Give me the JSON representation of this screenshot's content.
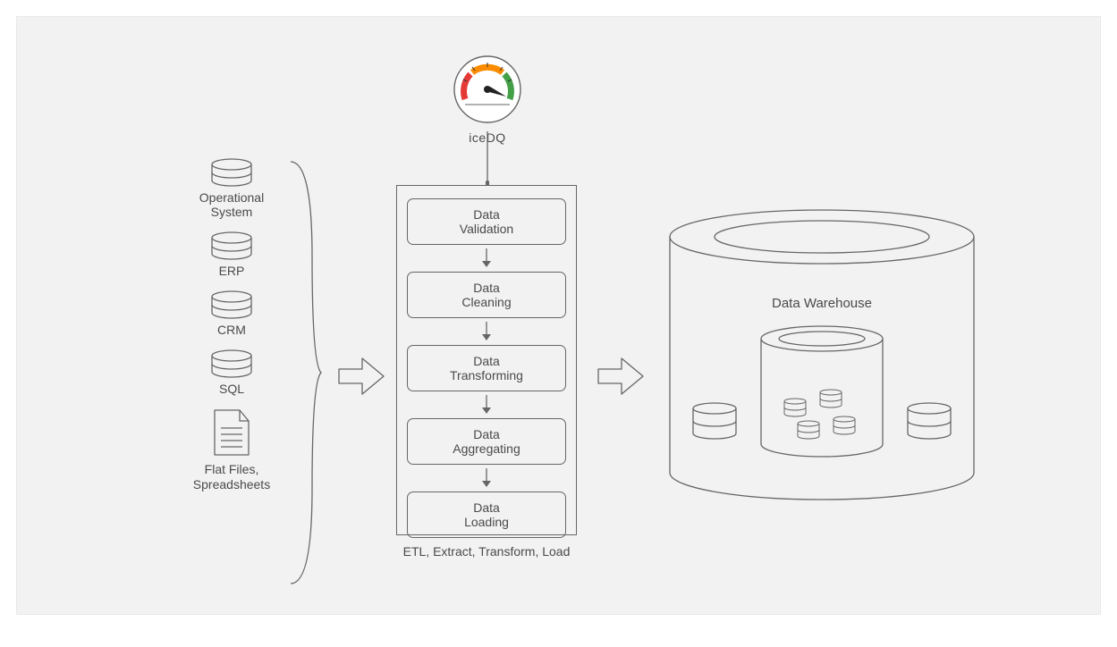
{
  "gauge": {
    "label": "iceDQ"
  },
  "sources": {
    "items": [
      {
        "label": "Operational\nSystem",
        "icon": "db"
      },
      {
        "label": "ERP",
        "icon": "db"
      },
      {
        "label": "CRM",
        "icon": "db"
      },
      {
        "label": "SQL",
        "icon": "db"
      },
      {
        "label": "Flat Files,\nSpreadsheets",
        "icon": "file"
      }
    ]
  },
  "pipeline": {
    "steps": [
      "Data\nValidation",
      "Data\nCleaning",
      "Data\nTransforming",
      "Data\nAggregating",
      "Data\nLoading"
    ],
    "caption": "ETL, Extract, Transform, Load"
  },
  "warehouse": {
    "label": "Data Warehouse"
  },
  "colors": {
    "stroke": "#666666",
    "gauge_red": "#e53935",
    "gauge_orange": "#fb8c00",
    "gauge_green": "#43a047"
  }
}
